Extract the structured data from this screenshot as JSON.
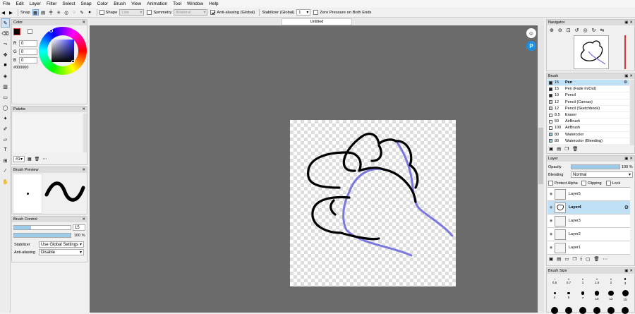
{
  "menu": [
    "File",
    "Edit",
    "Layer",
    "Filter",
    "Select",
    "Snap",
    "Color",
    "Brush",
    "View",
    "Animation",
    "Tool",
    "Window",
    "Help"
  ],
  "toolbar": {
    "snap_label": "Snap",
    "shape_label": "Shape",
    "shape_value": "Line",
    "symmetry_label": "Symmetry",
    "symmetry_value": "Bilateral",
    "antialias_label": "Anti-aliasing (Global)",
    "stabilizer_label": "Stabilizer (Global)",
    "stabilizer_value": "1",
    "zero_pressure_label": "Zero Pressure on Both Ends"
  },
  "document": {
    "tab_title": "Untitled"
  },
  "color_panel": {
    "title": "Color",
    "r_label": "R",
    "r_value": "0",
    "g_label": "G",
    "g_value": "0",
    "b_label": "B",
    "b_value": "0",
    "hex": "#000000"
  },
  "palette_panel": {
    "title": "Palette",
    "selector": "#1"
  },
  "brush_preview": {
    "title": "Brush Preview"
  },
  "brush_control": {
    "title": "Brush Control",
    "size_value": "15",
    "opacity_value": "100 %",
    "size_fraction": 0.3,
    "opacity_fraction": 1.0,
    "stabilizer_label": "Stabilizer",
    "stabilizer_value": "Use Global Settings",
    "antialias_label": "Anti-aliasing",
    "antialias_value": "Disable"
  },
  "navigator": {
    "title": "Navigator"
  },
  "brush_panel": {
    "title": "Brush",
    "items": [
      {
        "size": "15",
        "name": "Pen",
        "color": "#1a1a2e",
        "selected": true
      },
      {
        "size": "15",
        "name": "Pen (Fade In/Out)",
        "color": "#1a1a2e",
        "selected": false
      },
      {
        "size": "10",
        "name": "Pencil",
        "color": "#222222",
        "selected": false
      },
      {
        "size": "12",
        "name": "Pencil (Canvas)",
        "color": "#cccccc",
        "selected": false
      },
      {
        "size": "12",
        "name": "Pencil (Sketchbook)",
        "color": "#cccccc",
        "selected": false
      },
      {
        "size": "8.5",
        "name": "Eraser",
        "color": "#ffffff",
        "selected": false
      },
      {
        "size": "50",
        "name": "AirBrush",
        "color": "#ffffff",
        "selected": false
      },
      {
        "size": "100",
        "name": "AirBrush",
        "color": "#ffffff",
        "selected": false
      },
      {
        "size": "80",
        "name": "Watercolor",
        "color": "#7fd3e8",
        "selected": false
      },
      {
        "size": "80",
        "name": "Watercolor (Bleeding)",
        "color": "#7fd3e8",
        "selected": false
      }
    ]
  },
  "layer_panel": {
    "title": "Layer",
    "opacity_label": "Opacity",
    "opacity_value": "100 %",
    "opacity_fraction": 1.0,
    "blending_label": "Blending",
    "blending_value": "Normal",
    "protect_alpha_label": "Protect Alpha",
    "clipping_label": "Clipping",
    "lock_label": "Lock",
    "layers": [
      {
        "name": "Layer5",
        "selected": false
      },
      {
        "name": "Layer4",
        "selected": true
      },
      {
        "name": "Layer3",
        "selected": false
      },
      {
        "name": "Layer2",
        "selected": false
      },
      {
        "name": "Layer1",
        "selected": false
      }
    ]
  },
  "brush_size_panel": {
    "title": "Brush Size",
    "sizes": [
      "0.5",
      "0.7",
      "1",
      "1.5",
      "2",
      "3",
      "4",
      "5",
      "7",
      "10",
      "12",
      "15"
    ]
  }
}
